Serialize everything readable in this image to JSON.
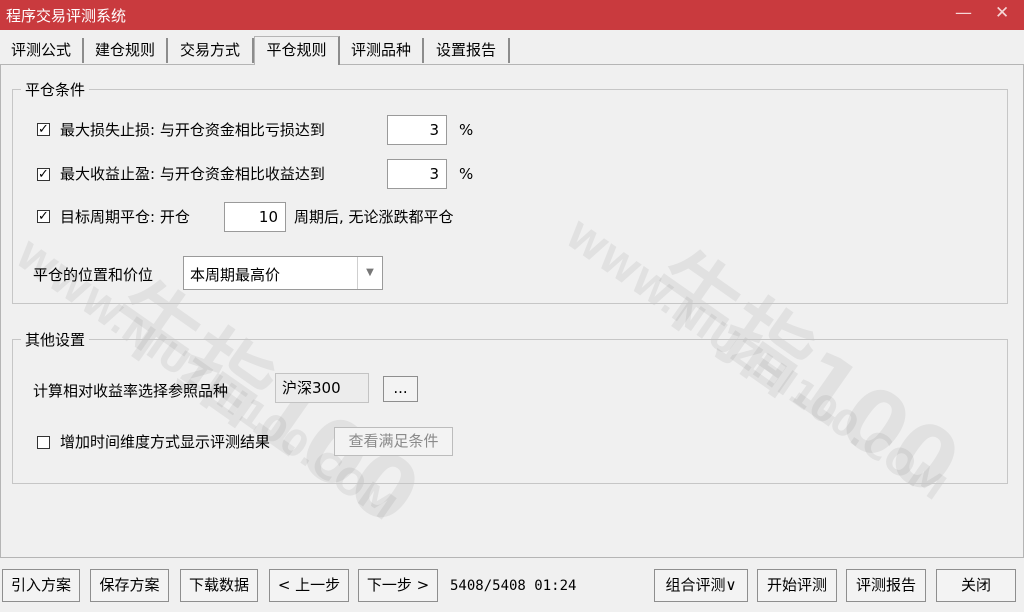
{
  "window": {
    "title": "程序交易评测系统",
    "minimize": "—",
    "close": "✕"
  },
  "tabs": [
    {
      "label": "评测公式"
    },
    {
      "label": "建仓规则"
    },
    {
      "label": "交易方式"
    },
    {
      "label": "平仓规则"
    },
    {
      "label": "评测品种"
    },
    {
      "label": "设置报告"
    }
  ],
  "active_tab": "平仓规则",
  "close_conditions": {
    "legend": "平仓条件",
    "stop_loss": {
      "checked": true,
      "check_mark": "✓",
      "label": "最大损失止损: 与开仓资金相比亏损达到",
      "value": "3",
      "unit": "%"
    },
    "take_profit": {
      "checked": true,
      "check_mark": "✓",
      "label": "最大收益止盈: 与开仓资金相比收益达到",
      "value": "3",
      "unit": "%"
    },
    "target_period": {
      "checked": true,
      "check_mark": "✓",
      "label_prefix": "目标周期平仓: 开仓",
      "value": "10",
      "label_suffix": "周期后, 无论涨跌都平仓"
    },
    "position_price": {
      "label": "平仓的位置和价位",
      "selected": "本周期最高价",
      "arrow": "▼"
    }
  },
  "other_settings": {
    "legend": "其他设置",
    "benchmark": {
      "label": "计算相对收益率选择参照品种",
      "value": "沪深300",
      "browse": "..."
    },
    "time_dimension": {
      "checked": false,
      "label": "增加时间维度方式显示评测结果",
      "view_button": "查看满足条件"
    }
  },
  "watermark": {
    "brand": "牛指100",
    "url": "WWW.NIUZHI100.COM"
  },
  "bottom_bar": {
    "import": "引入方案",
    "save": "保存方案",
    "download": "下载数据",
    "prev": "< 上一步",
    "next": "下一步 >",
    "status": "5408/5408 01:24",
    "combo": "组合评测∨",
    "start": "开始评测",
    "report": "评测报告",
    "close": "关闭"
  }
}
